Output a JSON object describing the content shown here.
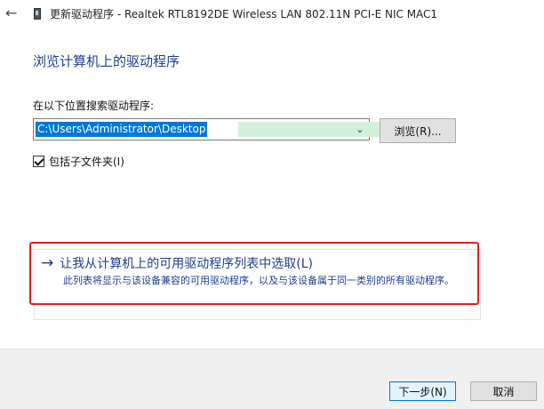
{
  "window": {
    "title": "更新驱动程序 - Realtek RTL8192DE Wireless LAN 802.11N PCI-E NIC MAC1",
    "back_icon": "back-arrow-icon",
    "device_icon": "network-adapter-icon"
  },
  "main": {
    "heading": "浏览计算机上的驱动程序",
    "search_label": "在以下位置搜索驱动程序:",
    "path_value": "C:\\Users\\Administrator\\Desktop",
    "browse_label": "浏览(R)...",
    "include_subfolders_label": "包括子文件夹(I)",
    "include_subfolders_checked": true
  },
  "pick_option": {
    "arrow": "→",
    "title": "让我从计算机上的可用驱动程序列表中选取(L)",
    "description": "此列表将显示与该设备兼容的可用驱动程序，以及与该设备属于同一类别的所有驱动程序。"
  },
  "footer": {
    "next_label": "下一步(N)",
    "cancel_label": "取消"
  },
  "colors": {
    "accent_text": "#1e3f8f",
    "selection": "#0078d7",
    "highlight_border": "#e02020",
    "footer_bg": "#f0f0f0"
  }
}
